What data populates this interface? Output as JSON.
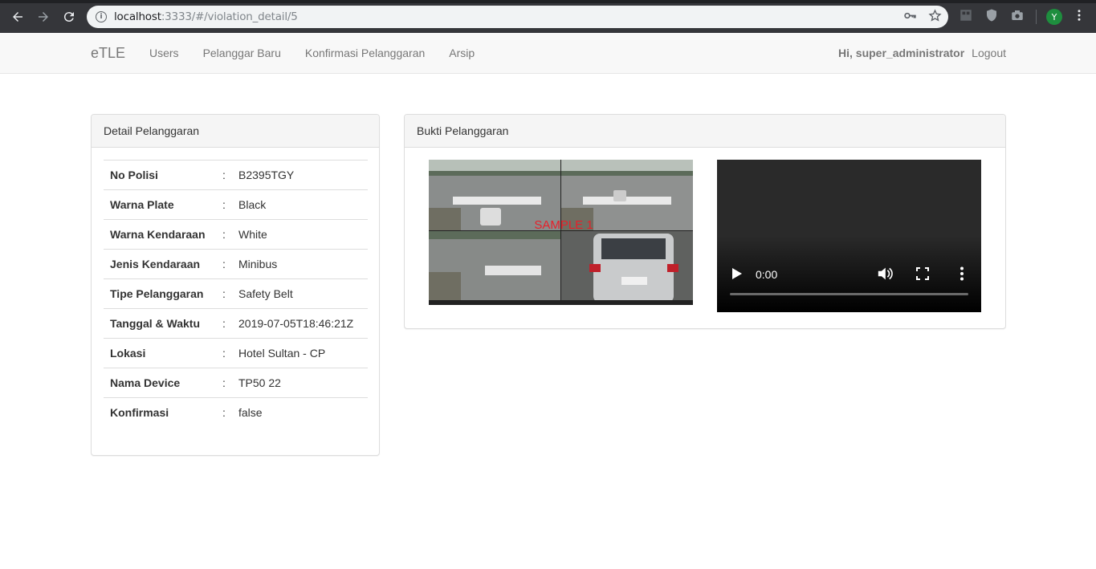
{
  "browser": {
    "url_host": "localhost",
    "url_rest": ":3333/#/violation_detail/5",
    "profile_initial": "Y"
  },
  "navbar": {
    "brand": "eTLE",
    "links": [
      "Users",
      "Pelanggar Baru",
      "Konfirmasi Pelanggaran",
      "Arsip"
    ],
    "greeting": "Hi, super_administrator",
    "logout": "Logout"
  },
  "detail_panel": {
    "title": "Detail Pelanggaran",
    "separator": ":",
    "rows": [
      {
        "label": "No Polisi",
        "value": "B2395TGY"
      },
      {
        "label": "Warna Plate",
        "value": "Black"
      },
      {
        "label": "Warna Kendaraan",
        "value": "White"
      },
      {
        "label": "Jenis Kendaraan",
        "value": "Minibus"
      },
      {
        "label": "Tipe Pelanggaran",
        "value": "Safety Belt"
      },
      {
        "label": "Tanggal & Waktu",
        "value": "2019-07-05T18:46:21Z"
      },
      {
        "label": "Lokasi",
        "value": "Hotel Sultan - CP"
      },
      {
        "label": "Nama Device",
        "value": "TP50 22"
      },
      {
        "label": "Konfirmasi",
        "value": "false"
      }
    ]
  },
  "bukti_panel": {
    "title": "Bukti Pelanggaran",
    "image_watermark": "SAMPLE 1",
    "video_time": "0:00"
  }
}
